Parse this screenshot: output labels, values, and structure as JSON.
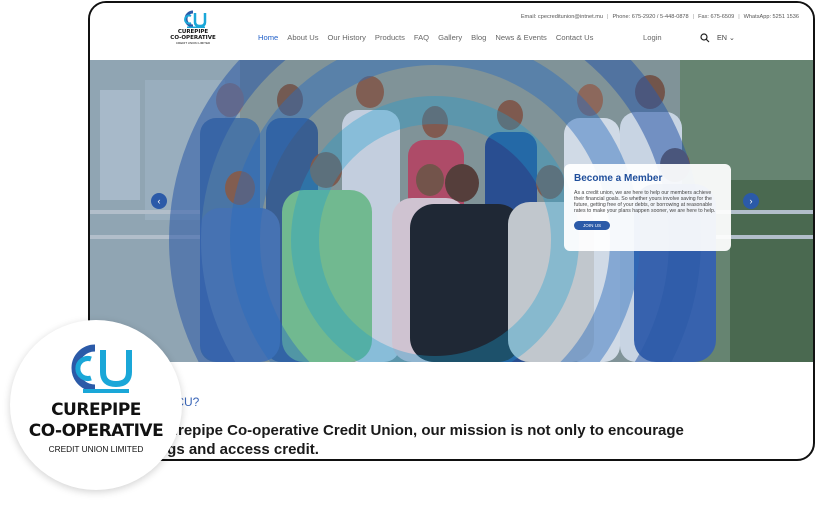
{
  "brand": {
    "line1": "CUREPIPE",
    "line2": "CO-OPERATIVE",
    "line3": "CREDIT UNION LIMITED",
    "colors": {
      "blue": "#2b5aa8",
      "cyan": "#1aa7d8"
    }
  },
  "contact": {
    "email": "Email: cpecreditunion@intnet.mu",
    "phone": "Phone: 675-2920 / 5-448-0878",
    "fax": "Fax: 675-6509",
    "whatsapp": "WhatsApp: 5251 1536"
  },
  "nav": {
    "items": [
      "Home",
      "About Us",
      "Our History",
      "Products",
      "FAQ",
      "Gallery",
      "Blog",
      "News & Events",
      "Contact Us"
    ],
    "active": "Home",
    "login": "Login",
    "lang": "EN",
    "search_icon": "search-icon"
  },
  "hero": {
    "prev_icon": "chevron-left-icon",
    "next_icon": "chevron-right-icon",
    "card": {
      "title": "Become a Member",
      "text": "As a credit union, we are here to help our members achieve their financial goals. So whether yours involve saving for the future, getting free of your debts, or borrowing at reasonable rates to make your plans happen sooner, we are here to help.",
      "button": "JOIN US"
    }
  },
  "section": {
    "why": "CCCU?",
    "mission": "Curepipe Co-operative Credit Union, our mission is not only to encourage\nngs and access credit."
  }
}
